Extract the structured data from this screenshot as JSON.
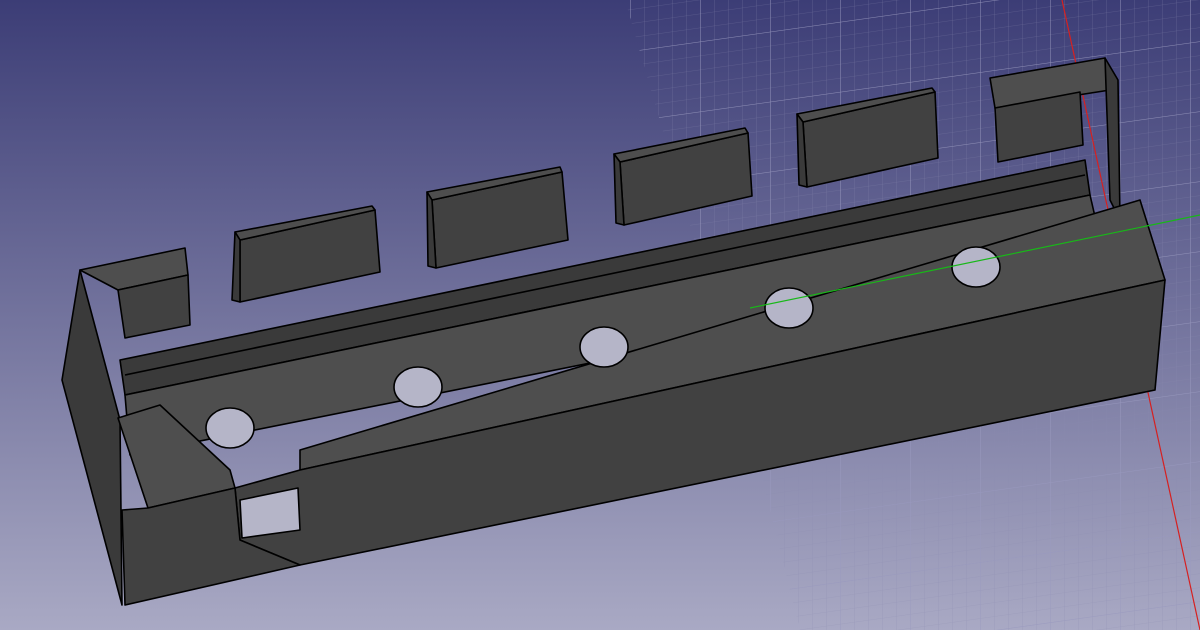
{
  "viewport": {
    "background_top": "#3c3d76",
    "background_bottom": "#a9a9c4"
  },
  "model": {
    "fill_color": "#414141",
    "side_color": "#3a3a3a",
    "top_face_color": "#4e4e4e",
    "edge_color": "#000000",
    "hole_interior_color": "#b5b5c8"
  },
  "grid": {
    "line_color": "#8a8ab0",
    "x_axis_color": "#d62020",
    "y_axis_color": "#18b818"
  }
}
